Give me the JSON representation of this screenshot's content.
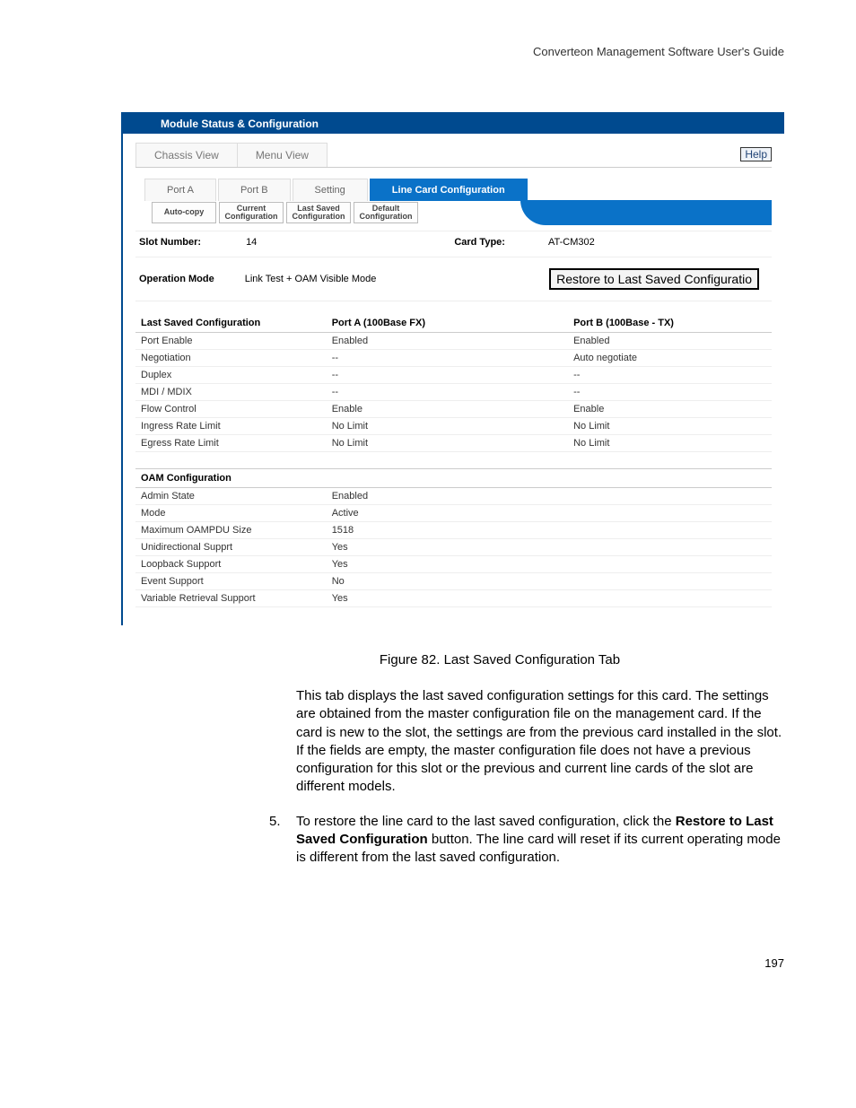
{
  "doc": {
    "header": "Converteon Management Software User's Guide",
    "page_number": "197"
  },
  "app": {
    "title": "Module Status & Configuration",
    "view_tabs": {
      "chassis": "Chassis View",
      "menu": "Menu View"
    },
    "help_label": "Help",
    "port_tabs": {
      "port_a": "Port A",
      "port_b": "Port B",
      "setting": "Setting",
      "line_card": "Line Card Configuration"
    },
    "sub_tabs": {
      "auto_copy": "Auto-copy",
      "current": "Current Configuration",
      "last_saved": "Last Saved Configuration",
      "default": "Default Configuration"
    },
    "info": {
      "slot_label": "Slot Number:",
      "slot_value": "14",
      "card_label": "Card Type:",
      "card_value": "AT-CM302"
    },
    "operation": {
      "label": "Operation Mode",
      "value": "Link Test + OAM Visible Mode"
    },
    "restore_button": "Restore to Last Saved Configuratio",
    "cfg_table": {
      "headers": {
        "col1": "Last Saved Configuration",
        "col2": "Port A (100Base FX)",
        "col3": "Port B (100Base - TX)"
      },
      "rows": [
        {
          "label": "Port Enable",
          "a": "Enabled",
          "b": "Enabled"
        },
        {
          "label": "Negotiation",
          "a": "--",
          "b": "Auto negotiate"
        },
        {
          "label": "Duplex",
          "a": "--",
          "b": "--"
        },
        {
          "label": "MDI / MDIX",
          "a": "--",
          "b": "--"
        },
        {
          "label": "Flow Control",
          "a": "Enable",
          "b": "Enable"
        },
        {
          "label": "Ingress Rate Limit",
          "a": "No Limit",
          "b": "No Limit"
        },
        {
          "label": "Egress Rate Limit",
          "a": "No Limit",
          "b": "No Limit"
        }
      ]
    },
    "oam_table": {
      "header": "OAM Configuration",
      "rows": [
        {
          "label": "Admin State",
          "value": "Enabled"
        },
        {
          "label": "Mode",
          "value": "Active"
        },
        {
          "label": "Maximum OAMPDU Size",
          "value": "1518"
        },
        {
          "label": "Unidirectional Supprt",
          "value": "Yes"
        },
        {
          "label": "Loopback Support",
          "value": "Yes"
        },
        {
          "label": "Event Support",
          "value": "No"
        },
        {
          "label": "Variable Retrieval Support",
          "value": "Yes"
        }
      ]
    }
  },
  "caption": "Figure 82. Last Saved Configuration Tab",
  "body1": "This tab displays the last saved configuration settings for this card. The settings are obtained from the master configuration file on the management card. If the card is new to the slot, the settings are from the previous card installed in the slot. If the fields are empty, the master configuration file does not have a previous configuration for this slot or the previous and current line cards of the slot are different models.",
  "step": {
    "num": "5.",
    "before": "To restore the line card to the last saved configuration, click the ",
    "bold": "Restore to Last Saved Configuration",
    "after": " button. The line card will reset if its current operating mode is different from the last saved configuration."
  }
}
